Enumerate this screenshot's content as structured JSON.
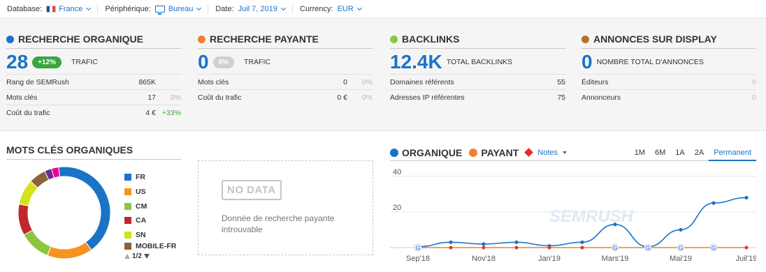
{
  "toolbar": {
    "database_label": "Database:",
    "database_value": "France",
    "device_label": "Périphérique:",
    "device_value": "Bureau",
    "date_label": "Date:",
    "date_value": "Juil 7, 2019",
    "currency_label": "Currency:",
    "currency_value": "EUR"
  },
  "cards": [
    {
      "title": "Recherche organique",
      "dot_color": "#1a73c7",
      "big": "28",
      "badge": "+12%",
      "big_label": "Trafic",
      "rows": [
        {
          "label": "Rang de SEMRush",
          "value": "865K",
          "pct": ""
        },
        {
          "label": "Mots clés",
          "value": "17",
          "pct": "0%"
        },
        {
          "label": "Coût du trafic",
          "value": "4 €",
          "pct": "+33%"
        }
      ]
    },
    {
      "title": "Recherche payante",
      "dot_color": "#f07f2f",
      "big": "0",
      "badge": "0%",
      "big_label": "Trafic",
      "rows": [
        {
          "label": "Mots clés",
          "value": "0",
          "pct": "0%"
        },
        {
          "label": "Coût du trafic",
          "value": "0 €",
          "pct": "0%"
        }
      ]
    },
    {
      "title": "Backlinks",
      "dot_color": "#8cc63f",
      "big": "12.4K",
      "big_label": "Total backlinks",
      "rows": [
        {
          "label": "Domaines référents",
          "value": "55",
          "pct": ""
        },
        {
          "label": "Adresses IP référentes",
          "value": "75",
          "pct": ""
        }
      ]
    },
    {
      "title": "Annonces sur display",
      "dot_color": "#b5702c",
      "big": "0",
      "big_label": "Nombre total d'annonces",
      "rows": [
        {
          "label": "Éditeurs",
          "value": "0",
          "pct": ""
        },
        {
          "label": "Annonceurs",
          "value": "0",
          "pct": ""
        }
      ]
    }
  ],
  "keywords": {
    "title": "Mots clés organiques",
    "legend": [
      {
        "label": "FR",
        "color": "#1a73c7"
      },
      {
        "label": "US",
        "color": "#f7931e"
      },
      {
        "label": "CM",
        "color": "#8cc63f"
      },
      {
        "label": "CA",
        "color": "#c1272d"
      },
      {
        "label": "SN",
        "color": "#d4e21a"
      },
      {
        "label": "MOBILE-FR",
        "color": "#8c6239"
      }
    ],
    "slices": [
      {
        "share": 0.42,
        "color": "#1a73c7"
      },
      {
        "share": 0.16,
        "color": "#f7931e"
      },
      {
        "share": 0.11,
        "color": "#8cc63f"
      },
      {
        "share": 0.11,
        "color": "#c1272d"
      },
      {
        "share": 0.09,
        "color": "#d4e21a"
      },
      {
        "share": 0.06,
        "color": "#8c6239"
      },
      {
        "share": 0.025,
        "color": "#662d91"
      },
      {
        "share": 0.025,
        "color": "#ec008c"
      }
    ],
    "pager": "1/2"
  },
  "paid": {
    "badge": "NO DATA",
    "message": "Donnée de recherche payante introuvable"
  },
  "trend": {
    "legend_organic": "Organique",
    "legend_organic_color": "#1a73c7",
    "legend_paid": "Payant",
    "legend_paid_color": "#f07f2f",
    "notes_label": "Notes",
    "periods": [
      "1M",
      "6M",
      "1A",
      "2A",
      "Permanent"
    ],
    "active_period": "Permanent",
    "watermark": "SEMRUSH"
  },
  "chart_data": {
    "type": "line",
    "x_ticks": [
      "Sep'18",
      "Nov'18",
      "Jan'19",
      "Mars'19",
      "Mai'19",
      "Juil'19"
    ],
    "y_ticks": [
      40,
      20
    ],
    "ylim": [
      0,
      45
    ],
    "series": [
      {
        "name": "Organique",
        "color": "#1a73c7",
        "x": [
          0,
          1,
          2,
          3,
          4,
          5,
          6,
          7,
          8,
          9,
          10
        ],
        "values": [
          0.5,
          3,
          2,
          3,
          1,
          3,
          13,
          0.5,
          10,
          25,
          28
        ]
      },
      {
        "name": "Payant",
        "color": "#f07f2f",
        "x": [
          0,
          1,
          2,
          3,
          4,
          5,
          6,
          7,
          8,
          9,
          10
        ],
        "values": [
          0,
          0,
          0,
          0,
          0,
          0,
          0,
          0,
          0,
          0,
          0
        ]
      }
    ],
    "google_markers_x": [
      0,
      6,
      7,
      8,
      9
    ],
    "note_markers_x": [
      1,
      2,
      3,
      4,
      5,
      10
    ]
  }
}
